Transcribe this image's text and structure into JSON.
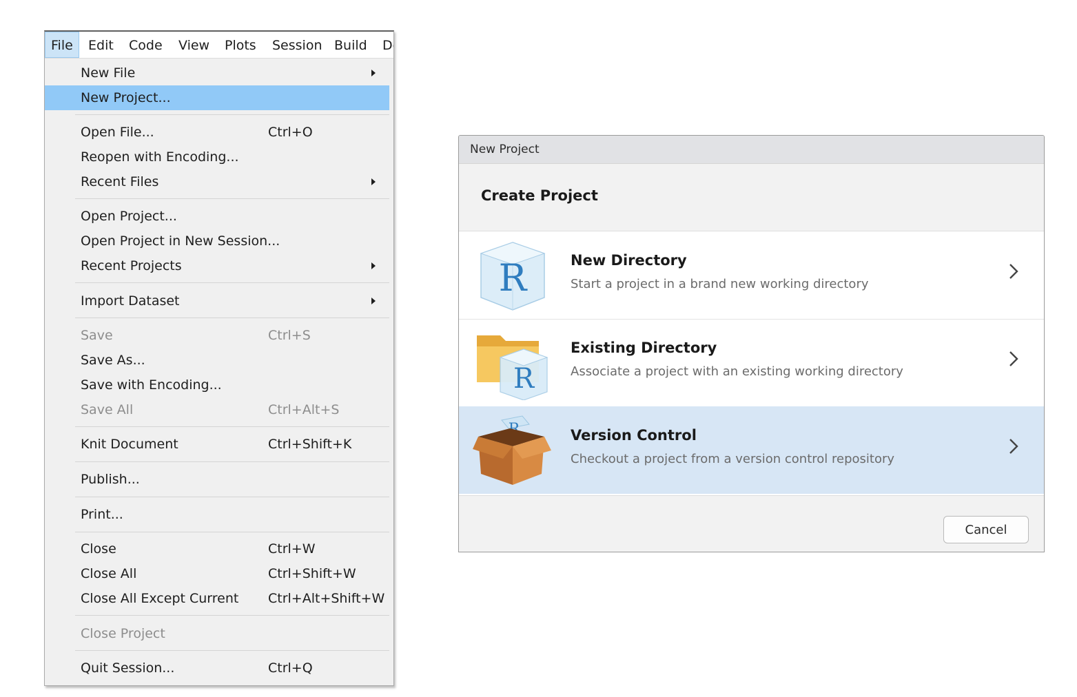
{
  "menubar": {
    "items": [
      "File",
      "Edit",
      "Code",
      "View",
      "Plots",
      "Session",
      "Build",
      "De"
    ]
  },
  "file_menu": {
    "items": [
      {
        "label": "New File",
        "shortcut": "",
        "submenu": true
      },
      {
        "label": "New Project...",
        "shortcut": "",
        "highlighted": true
      },
      {
        "label": "Open File...",
        "shortcut": "Ctrl+O"
      },
      {
        "label": "Reopen with Encoding...",
        "shortcut": ""
      },
      {
        "label": "Recent Files",
        "shortcut": "",
        "submenu": true
      },
      {
        "label": "Open Project...",
        "shortcut": ""
      },
      {
        "label": "Open Project in New Session...",
        "shortcut": ""
      },
      {
        "label": "Recent Projects",
        "shortcut": "",
        "submenu": true
      },
      {
        "label": "Import Dataset",
        "shortcut": "",
        "submenu": true
      },
      {
        "label": "Save",
        "shortcut": "Ctrl+S",
        "disabled": true
      },
      {
        "label": "Save As...",
        "shortcut": ""
      },
      {
        "label": "Save with Encoding...",
        "shortcut": ""
      },
      {
        "label": "Save All",
        "shortcut": "Ctrl+Alt+S",
        "disabled": true
      },
      {
        "label": "Knit Document",
        "shortcut": "Ctrl+Shift+K"
      },
      {
        "label": "Publish...",
        "shortcut": ""
      },
      {
        "label": "Print...",
        "shortcut": ""
      },
      {
        "label": "Close",
        "shortcut": "Ctrl+W"
      },
      {
        "label": "Close All",
        "shortcut": "Ctrl+Shift+W"
      },
      {
        "label": "Close All Except Current",
        "shortcut": "Ctrl+Alt+Shift+W"
      },
      {
        "label": "Close Project",
        "shortcut": "",
        "disabled": true
      },
      {
        "label": "Quit Session...",
        "shortcut": "Ctrl+Q"
      }
    ],
    "highlight_color": "#91c9f7"
  },
  "dialog": {
    "window_title": "New Project",
    "heading": "Create Project",
    "options": [
      {
        "title": "New Directory",
        "description": "Start a project in a brand new working directory",
        "icon": "r-cube-icon"
      },
      {
        "title": "Existing Directory",
        "description": "Associate a project with an existing working directory",
        "icon": "folder-r-icon"
      },
      {
        "title": "Version Control",
        "description": "Checkout a project from a version control repository",
        "icon": "cardboard-box-icon",
        "selected": true
      }
    ],
    "selected_color": "#d7e6f5",
    "cancel_label": "Cancel"
  }
}
